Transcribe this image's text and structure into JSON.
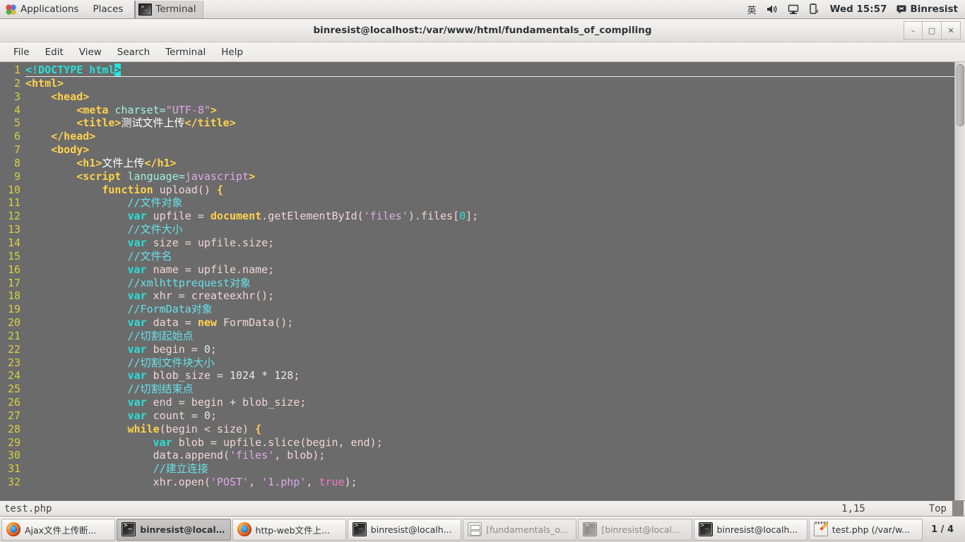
{
  "top_panel": {
    "applications_label": "Applications",
    "places_label": "Places",
    "window_button_label": "Terminal",
    "window_button_icon": "terminal-icon",
    "tray": {
      "input_method": "英",
      "volume_icon": "speaker-icon",
      "display_icon": "monitor-icon",
      "power_icon": "battery-icon",
      "clock": "Wed 15:57",
      "user_icon": "chat-icon",
      "user_name": "Binresist"
    }
  },
  "window": {
    "title": "binresist@localhost:/var/www/html/fundamentals_of_compiling",
    "controls": {
      "minimize": "–",
      "maximize": "□",
      "close": "✕"
    },
    "menu": [
      "File",
      "Edit",
      "View",
      "Search",
      "Terminal",
      "Help"
    ]
  },
  "editor": {
    "lines": [
      {
        "n": "1",
        "current": true,
        "tokens": [
          {
            "t": "<!DOCTYPE html",
            "c": "kw"
          },
          {
            "t": ">",
            "c": "cursor"
          }
        ]
      },
      {
        "n": "2",
        "tokens": [
          {
            "t": "<html>",
            "c": "tag"
          }
        ]
      },
      {
        "n": "3",
        "tokens": [
          {
            "t": "    ",
            "c": "plain"
          },
          {
            "t": "<head>",
            "c": "tag"
          }
        ]
      },
      {
        "n": "4",
        "tokens": [
          {
            "t": "        ",
            "c": "plain"
          },
          {
            "t": "<meta ",
            "c": "tag"
          },
          {
            "t": "charset=",
            "c": "attr"
          },
          {
            "t": "\"UTF-8\"",
            "c": "str"
          },
          {
            "t": ">",
            "c": "tag"
          }
        ]
      },
      {
        "n": "5",
        "tokens": [
          {
            "t": "        ",
            "c": "plain"
          },
          {
            "t": "<title>",
            "c": "tag"
          },
          {
            "t": "测试文件上传",
            "c": "cjk"
          },
          {
            "t": "</title>",
            "c": "tag"
          }
        ]
      },
      {
        "n": "6",
        "tokens": [
          {
            "t": "    ",
            "c": "plain"
          },
          {
            "t": "</head>",
            "c": "tag"
          }
        ]
      },
      {
        "n": "7",
        "tokens": [
          {
            "t": "    ",
            "c": "plain"
          },
          {
            "t": "<body>",
            "c": "tag"
          }
        ]
      },
      {
        "n": "8",
        "tokens": [
          {
            "t": "        ",
            "c": "plain"
          },
          {
            "t": "<h1>",
            "c": "tag"
          },
          {
            "t": "文件上传",
            "c": "cjk"
          },
          {
            "t": "</h1>",
            "c": "tag"
          }
        ]
      },
      {
        "n": "9",
        "tokens": [
          {
            "t": "        ",
            "c": "plain"
          },
          {
            "t": "<script ",
            "c": "tag"
          },
          {
            "t": "language=",
            "c": "attr"
          },
          {
            "t": "javascript",
            "c": "str"
          },
          {
            "t": ">",
            "c": "tag"
          }
        ]
      },
      {
        "n": "10",
        "tokens": [
          {
            "t": "            ",
            "c": "plain"
          },
          {
            "t": "function",
            "c": "kw2"
          },
          {
            "t": " upload() ",
            "c": "ident"
          },
          {
            "t": "{",
            "c": "kw2"
          }
        ]
      },
      {
        "n": "11",
        "tokens": [
          {
            "t": "                ",
            "c": "plain"
          },
          {
            "t": "//文件对象",
            "c": "cmt-cjk"
          }
        ]
      },
      {
        "n": "12",
        "tokens": [
          {
            "t": "                ",
            "c": "plain"
          },
          {
            "t": "var",
            "c": "kw"
          },
          {
            "t": " upfile = ",
            "c": "ident"
          },
          {
            "t": "document",
            "c": "kw2"
          },
          {
            "t": ".getElementById(",
            "c": "ident"
          },
          {
            "t": "'files'",
            "c": "str"
          },
          {
            "t": ").files[",
            "c": "ident"
          },
          {
            "t": "0",
            "c": "numc"
          },
          {
            "t": "];",
            "c": "ident"
          }
        ]
      },
      {
        "n": "13",
        "tokens": [
          {
            "t": "                ",
            "c": "plain"
          },
          {
            "t": "//文件大小",
            "c": "cmt-cjk"
          }
        ]
      },
      {
        "n": "14",
        "tokens": [
          {
            "t": "                ",
            "c": "plain"
          },
          {
            "t": "var",
            "c": "kw"
          },
          {
            "t": " size = upfile.size;",
            "c": "ident"
          }
        ]
      },
      {
        "n": "15",
        "tokens": [
          {
            "t": "                ",
            "c": "plain"
          },
          {
            "t": "//文件名",
            "c": "cmt-cjk"
          }
        ]
      },
      {
        "n": "16",
        "tokens": [
          {
            "t": "                ",
            "c": "plain"
          },
          {
            "t": "var",
            "c": "kw"
          },
          {
            "t": " name = upfile.name;",
            "c": "ident"
          }
        ]
      },
      {
        "n": "17",
        "tokens": [
          {
            "t": "                ",
            "c": "plain"
          },
          {
            "t": "//xmlhttprequest对象",
            "c": "cmt-cjk"
          }
        ]
      },
      {
        "n": "18",
        "tokens": [
          {
            "t": "                ",
            "c": "plain"
          },
          {
            "t": "var",
            "c": "kw"
          },
          {
            "t": " xhr = createexhr();",
            "c": "ident"
          }
        ]
      },
      {
        "n": "19",
        "tokens": [
          {
            "t": "                ",
            "c": "plain"
          },
          {
            "t": "//FormData对象",
            "c": "cmt-cjk"
          }
        ]
      },
      {
        "n": "20",
        "tokens": [
          {
            "t": "                ",
            "c": "plain"
          },
          {
            "t": "var",
            "c": "kw"
          },
          {
            "t": " data = ",
            "c": "ident"
          },
          {
            "t": "new",
            "c": "kw2"
          },
          {
            "t": " FormData();",
            "c": "ident"
          }
        ]
      },
      {
        "n": "21",
        "tokens": [
          {
            "t": "                ",
            "c": "plain"
          },
          {
            "t": "//切割起始点",
            "c": "cmt-cjk"
          }
        ]
      },
      {
        "n": "22",
        "tokens": [
          {
            "t": "                ",
            "c": "plain"
          },
          {
            "t": "var",
            "c": "kw"
          },
          {
            "t": " begin = ",
            "c": "ident"
          },
          {
            "t": "0",
            "c": "num"
          },
          {
            "t": ";",
            "c": "ident"
          }
        ]
      },
      {
        "n": "23",
        "tokens": [
          {
            "t": "                ",
            "c": "plain"
          },
          {
            "t": "//切割文件块大小",
            "c": "cmt-cjk"
          }
        ]
      },
      {
        "n": "24",
        "tokens": [
          {
            "t": "                ",
            "c": "plain"
          },
          {
            "t": "var",
            "c": "kw"
          },
          {
            "t": " blob_size = ",
            "c": "ident"
          },
          {
            "t": "1024 * 128",
            "c": "num"
          },
          {
            "t": ";",
            "c": "ident"
          }
        ]
      },
      {
        "n": "25",
        "tokens": [
          {
            "t": "                ",
            "c": "plain"
          },
          {
            "t": "//切割结束点",
            "c": "cmt-cjk"
          }
        ]
      },
      {
        "n": "26",
        "tokens": [
          {
            "t": "                ",
            "c": "plain"
          },
          {
            "t": "var",
            "c": "kw"
          },
          {
            "t": " end = begin + blob_size;",
            "c": "ident"
          }
        ]
      },
      {
        "n": "27",
        "tokens": [
          {
            "t": "                ",
            "c": "plain"
          },
          {
            "t": "var",
            "c": "kw"
          },
          {
            "t": " count = ",
            "c": "ident"
          },
          {
            "t": "0",
            "c": "num"
          },
          {
            "t": ";",
            "c": "ident"
          }
        ]
      },
      {
        "n": "28",
        "tokens": [
          {
            "t": "                ",
            "c": "plain"
          },
          {
            "t": "while",
            "c": "kw2"
          },
          {
            "t": "(begin < size) ",
            "c": "ident"
          },
          {
            "t": "{",
            "c": "kw2"
          }
        ]
      },
      {
        "n": "29",
        "tokens": [
          {
            "t": "                    ",
            "c": "plain"
          },
          {
            "t": "var",
            "c": "kw"
          },
          {
            "t": " blob = upfile.slice(begin, end);",
            "c": "ident"
          }
        ]
      },
      {
        "n": "30",
        "tokens": [
          {
            "t": "                    ",
            "c": "plain"
          },
          {
            "t": "data.append(",
            "c": "ident"
          },
          {
            "t": "'files'",
            "c": "str"
          },
          {
            "t": ", blob);",
            "c": "ident"
          }
        ]
      },
      {
        "n": "31",
        "tokens": [
          {
            "t": "                    ",
            "c": "plain"
          },
          {
            "t": "//建立连接",
            "c": "cmt-cjk"
          }
        ]
      },
      {
        "n": "32",
        "tokens": [
          {
            "t": "                    ",
            "c": "plain"
          },
          {
            "t": "xhr.open(",
            "c": "ident"
          },
          {
            "t": "'POST'",
            "c": "str"
          },
          {
            "t": ", ",
            "c": "ident"
          },
          {
            "t": "'1.php'",
            "c": "str"
          },
          {
            "t": ", ",
            "c": "ident"
          },
          {
            "t": "true",
            "c": "bool"
          },
          {
            "t": ");",
            "c": "ident"
          }
        ]
      }
    ]
  },
  "status_line": {
    "file": "test.php",
    "position": "1,15",
    "scroll": "Top"
  },
  "taskbar": {
    "items": [
      {
        "label": "Ajax文件上传断...",
        "icon": "firefox-icon",
        "state": "normal"
      },
      {
        "label": "binresist@localh...",
        "icon": "terminal-icon",
        "state": "active"
      },
      {
        "label": "http-web文件上...",
        "icon": "firefox-icon",
        "state": "normal"
      },
      {
        "label": "binresist@localh...",
        "icon": "terminal-icon",
        "state": "normal"
      },
      {
        "label": "[fundamentals_o...",
        "icon": "files-icon",
        "state": "minimized"
      },
      {
        "label": "[binresist@local...",
        "icon": "terminal-icon",
        "state": "minimized"
      },
      {
        "label": "binresist@localh...",
        "icon": "terminal-icon",
        "state": "normal"
      },
      {
        "label": "test.php (/var/w...",
        "icon": "gedit-icon",
        "state": "normal"
      }
    ],
    "workspace": "1 / 4"
  }
}
